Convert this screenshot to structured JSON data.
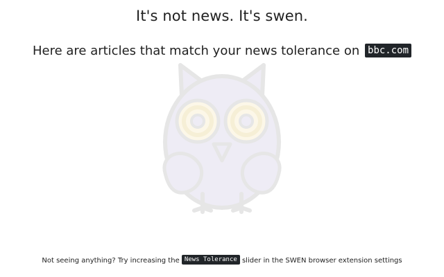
{
  "heading": "It's not news. It's swen.",
  "subheading": {
    "text": "Here are articles that match your news tolerance on",
    "site": "bbc.com"
  },
  "mascot_icon": "owl-icon",
  "footer": {
    "before": "Not seeing anything? Try increasing the",
    "setting": "News Tolerance",
    "after": "slider in the SWEN browser extension settings"
  },
  "colors": {
    "code_bg": "#212529",
    "owl_body": "#eeecf5",
    "owl_eye": "#fcf7e8",
    "owl_outline": "#e6e6e6"
  }
}
